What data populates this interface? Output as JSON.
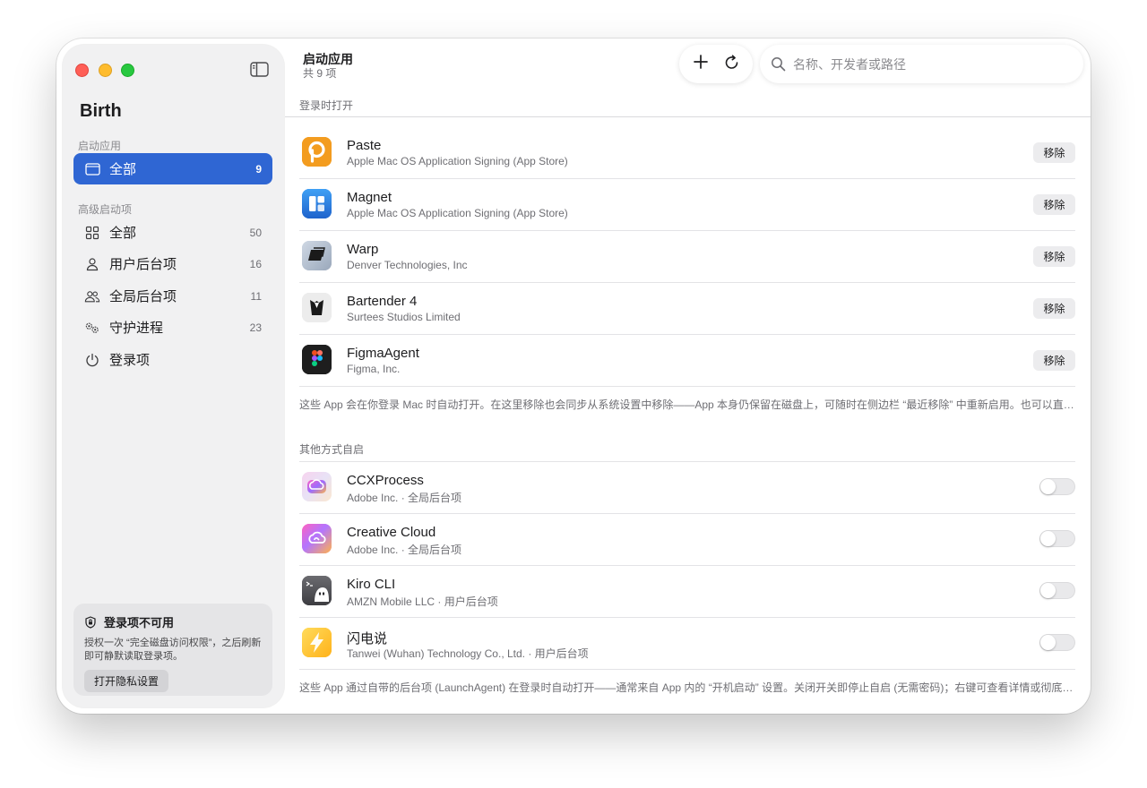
{
  "window": {
    "app_name": "Birth"
  },
  "sidebar": {
    "section_startup_label": "启动应用",
    "section_advanced_label": "高级启动项",
    "startup_items": [
      {
        "label": "全部",
        "count": "9",
        "icon": "window-icon",
        "active": true
      }
    ],
    "advanced_items": [
      {
        "label": "全部",
        "count": "50",
        "icon": "grid-icon"
      },
      {
        "label": "用户后台项",
        "count": "16",
        "icon": "person-icon"
      },
      {
        "label": "全局后台项",
        "count": "11",
        "icon": "people-icon"
      },
      {
        "label": "守护进程",
        "count": "23",
        "icon": "gears-icon"
      },
      {
        "label": "登录项",
        "count": "",
        "icon": "power-icon"
      }
    ],
    "info_card": {
      "title": "登录项不可用",
      "body": "授权一次 “完全磁盘访问权限”，之后刷新即可静默读取登录项。",
      "button": "打开隐私设置"
    }
  },
  "header": {
    "title": "启动应用",
    "subtitle": "共 9 项",
    "search_placeholder": "名称、开发者或路径"
  },
  "login_group": {
    "label": "登录时打开",
    "remove_label": "移除",
    "items": [
      {
        "name": "Paste",
        "developer": "Apple Mac OS Application Signing (App Store)",
        "icon": "paste-icon",
        "color": "#f39c1f"
      },
      {
        "name": "Magnet",
        "developer": "Apple Mac OS Application Signing (App Store)",
        "icon": "magnet-icon",
        "color": "#2b7fe0"
      },
      {
        "name": "Warp",
        "developer": "Denver Technologies, Inc",
        "icon": "warp-icon",
        "color": "#b9c4d3"
      },
      {
        "name": "Bartender 4",
        "developer": "Surtees Studios Limited",
        "icon": "bartender-icon",
        "color": "#e8e8e8"
      },
      {
        "name": "FigmaAgent",
        "developer": "Figma, Inc.",
        "icon": "figma-icon",
        "color": "#1e1e1e"
      }
    ],
    "footnote": "这些 App 会在你登录 Mac 时自动打开。在这里移除也会同步从系统设置中移除——App 本身仍保留在磁盘上，可随时在侧边栏 “最近移除” 中重新启用。也可以直接把 App 拖..."
  },
  "other_group": {
    "label": "其他方式自启",
    "items": [
      {
        "name": "CCXProcess",
        "developer": "Adobe Inc. · 全局后台项",
        "icon": "creative-cloud-icon",
        "enabled": false
      },
      {
        "name": "Creative Cloud",
        "developer": "Adobe Inc. · 全局后台项",
        "icon": "creative-cloud-icon",
        "enabled": false
      },
      {
        "name": "Kiro CLI",
        "developer": "AMZN Mobile LLC · 用户后台项",
        "icon": "kiro-icon",
        "enabled": false
      },
      {
        "name": "闪电说",
        "developer": "Tanwei (Wuhan) Technology Co., Ltd. · 用户后台项",
        "icon": "lightning-icon",
        "enabled": false
      }
    ],
    "footnote": "这些 App 通过自带的后台项 (LaunchAgent) 在登录时自动打开——通常来自 App 内的 “开机启动” 设置。关闭开关即停止自启 (无需密码)；右键可查看详情或彻底移除。"
  },
  "colors": {
    "accent": "#2f66d3",
    "sidebar_bg": "#f1f1f2"
  }
}
